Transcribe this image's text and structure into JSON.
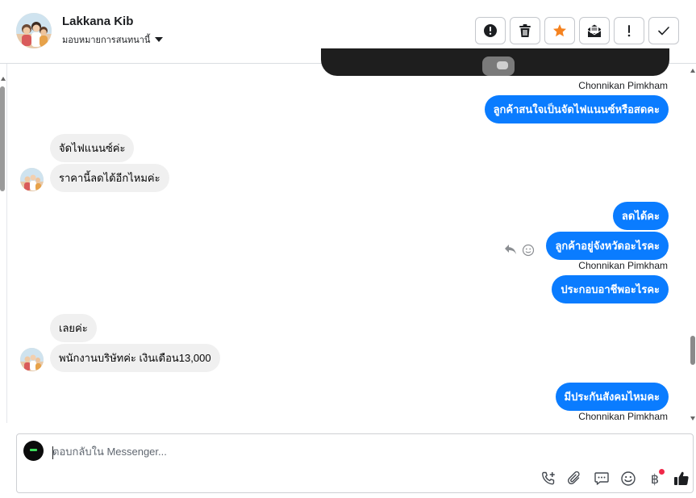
{
  "header": {
    "contact_name": "Lakkana Kib",
    "assign_label": "มอบหมายการสนทนานี้",
    "toolbar": [
      "spam-button",
      "delete-button",
      "star-button",
      "mark-unread-button",
      "follow-up-button",
      "done-button"
    ]
  },
  "messages": [
    {
      "side": "out",
      "sender": "Chonnikan Pimkham"
    },
    {
      "side": "out",
      "text": "ลูกค้าสนใจเป็นจัดไฟแนนซ์หรือสดคะ"
    },
    {
      "side": "in",
      "text": "จัดไฟแนนซ์ค่ะ"
    },
    {
      "side": "in",
      "text": "ราคานี้ลดได้อีกไหมค่ะ"
    },
    {
      "side": "out",
      "text": "ลดได้คะ"
    },
    {
      "side": "out",
      "text": "ลูกค้าอยู่จังหวัดอะไรคะ"
    },
    {
      "side": "out",
      "sender": "Chonnikan Pimkham"
    },
    {
      "side": "out",
      "text": "ประกอบอาชีพอะไรคะ"
    },
    {
      "side": "in",
      "text": "เลยค่ะ"
    },
    {
      "side": "in",
      "text": "พนักงานบริษัทค่ะ เงินเดือน13,000"
    },
    {
      "side": "out",
      "text": "มีประกันสังคมไหมคะ"
    },
    {
      "side": "out",
      "sender": "Chonnikan Pimkham"
    }
  ],
  "composer": {
    "placeholder": "ตอบกลับใน Messenger...",
    "tools": [
      "call-add-icon",
      "attachment-icon",
      "saved-reply-icon",
      "emoji-icon",
      "baht-payment-icon",
      "like-icon"
    ],
    "baht_symbol": "฿"
  },
  "colors": {
    "outgoing_bubble": "#0a7cff",
    "incoming_bubble": "#f0f0f0",
    "notification_dot": "#f02849"
  }
}
